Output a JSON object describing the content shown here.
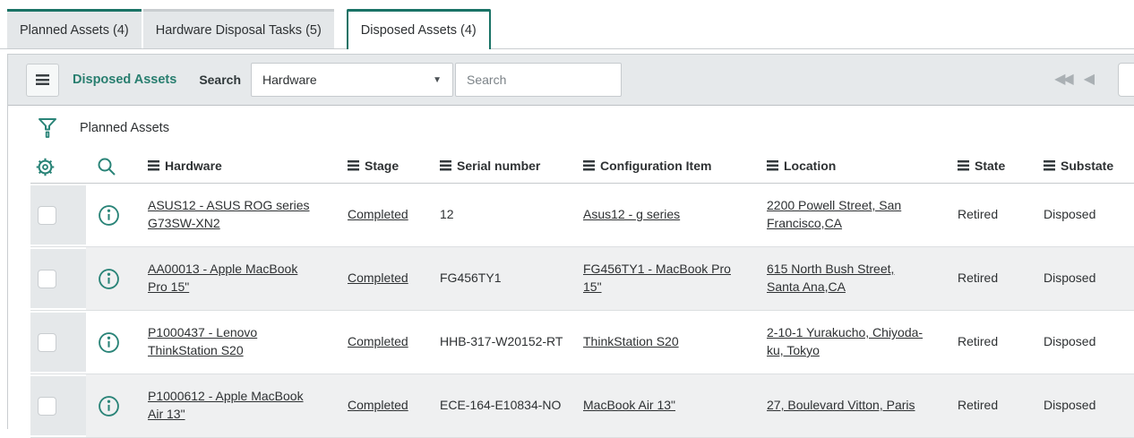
{
  "tabs": [
    {
      "label": "Planned Assets (4)",
      "active": false
    },
    {
      "label": "Hardware Disposal Tasks (5)",
      "active": false
    },
    {
      "label": "Disposed Assets (4)",
      "active": true
    }
  ],
  "toolbar": {
    "title": "Disposed Assets",
    "search_label": "Search",
    "search_field_selected": "Hardware",
    "search_placeholder": "Search"
  },
  "icons": {
    "menu": "hamburger-bars",
    "filter": "funnel",
    "settings": "gear",
    "search": "magnifier",
    "info": "circle-i",
    "column_menu": "hamburger-bars",
    "dropdown_arrow": "▼",
    "first_page": "◀◀",
    "previous_page": "◀"
  },
  "breadcrumb": {
    "label": "Planned Assets"
  },
  "table": {
    "columns": [
      "Hardware",
      "Stage",
      "Serial number",
      "Configuration Item",
      "Location",
      "State",
      "Substate"
    ],
    "rows": [
      {
        "hardware": "ASUS12 - ASUS ROG series G73SW-XN2",
        "stage": "Completed",
        "serial_number": "12",
        "configuration_item": "Asus12 - g series",
        "location": "2200 Powell Street, San Francisco,CA",
        "state": "Retired",
        "substate": "Disposed"
      },
      {
        "hardware": "AA00013 - Apple MacBook Pro 15\"",
        "stage": "Completed",
        "serial_number": "FG456TY1",
        "configuration_item": "FG456TY1 - MacBook Pro 15\"",
        "location": "615 North Bush Street, Santa Ana,CA",
        "state": "Retired",
        "substate": "Disposed"
      },
      {
        "hardware": "P1000437 - Lenovo ThinkStation S20",
        "stage": "Completed",
        "serial_number": "HHB-317-W20152-RT",
        "configuration_item": "ThinkStation S20",
        "location": "2-10-1 Yurakucho, Chiyoda-ku, Tokyo",
        "state": "Retired",
        "substate": "Disposed"
      },
      {
        "hardware": "P1000612 - Apple MacBook Air 13\"",
        "stage": "Completed",
        "serial_number": "ECE-164-E10834-NO",
        "configuration_item": "MacBook Air 13\"",
        "location": "27, Boulevard Vitton, Paris",
        "state": "Retired",
        "substate": "Disposed"
      }
    ]
  },
  "colors": {
    "accent_teal": "#287E6F",
    "tab_border_teal": "#1A7366",
    "toolbar_bg": "#E6E9EB",
    "row_alt_bg": "#EFF0F1",
    "checkbox_column_bg": "#E5E8EA",
    "border": "#C9CDD0",
    "text": "#2E3133"
  }
}
